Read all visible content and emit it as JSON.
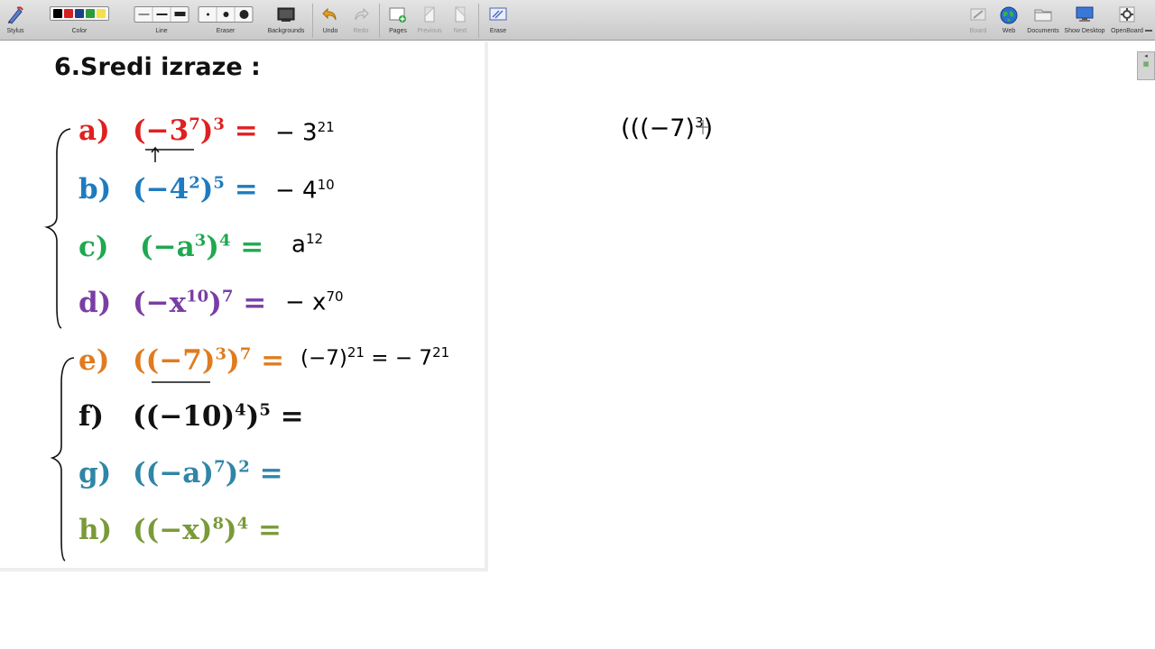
{
  "toolbar": {
    "stylus": "Stylus",
    "color": "Color",
    "line": "Line",
    "eraser": "Eraser",
    "backgrounds": "Backgrounds",
    "undo": "Undo",
    "redo": "Redo",
    "pages": "Pages",
    "previous": "Previous",
    "next": "Next",
    "erase": "Erase",
    "board": "Board",
    "web": "Web",
    "documents": "Documents",
    "show_desktop": "Show Desktop",
    "openboard": "OpenBoard"
  },
  "colors": {
    "swatches": [
      "#000000",
      "#d42020",
      "#1c3f8a",
      "#2a9d3a",
      "#f5e04a"
    ],
    "red": "#e02020",
    "blue": "#1f7bbf",
    "green": "#1fa850",
    "purple": "#7a3ea3",
    "orange": "#e07b20",
    "black": "#111111",
    "teal": "#2f86a6",
    "olive": "#7a9a3a"
  },
  "page": {
    "title": "6.Sredi izraze :",
    "problems": [
      {
        "letter": "a)",
        "base": "(−3",
        "inner_exp": "7",
        "close": ")",
        "outer_exp": "3",
        "eq": "=",
        "answer": "− 3",
        "answer_exp": "21"
      },
      {
        "letter": "b)",
        "base": "(−4",
        "inner_exp": "2",
        "close": ")",
        "outer_exp": "5",
        "eq": "=",
        "answer": "− 4",
        "answer_exp": "10"
      },
      {
        "letter": "c)",
        "base": "(−a",
        "inner_exp": "3",
        "close": ")",
        "outer_exp": "4",
        "eq": "=",
        "answer": "a",
        "answer_exp": "12"
      },
      {
        "letter": "d)",
        "base": "(−x",
        "inner_exp": "10",
        "close": ")",
        "outer_exp": "7",
        "eq": "=",
        "answer": "− x",
        "answer_exp": "70"
      },
      {
        "letter": "e)",
        "base": "((−7)",
        "inner_exp": "3",
        "close": ")",
        "outer_exp": "7",
        "eq": "=",
        "answer": "(−7)",
        "answer_exp": "21",
        "answer2": "= − 7",
        "answer2_exp": "21"
      },
      {
        "letter": "f)",
        "base": "((−10)",
        "inner_exp": "4",
        "close": ")",
        "outer_exp": "5",
        "eq": "="
      },
      {
        "letter": "g)",
        "base": "((−a)",
        "inner_exp": "7",
        "close": ")",
        "outer_exp": "2",
        "eq": "="
      },
      {
        "letter": "h)",
        "base": "((−x)",
        "inner_exp": "8",
        "close": ")",
        "outer_exp": "4",
        "eq": "="
      }
    ]
  },
  "board_note": {
    "text": "((−7)",
    "inner_exp": "3",
    "close": ")"
  }
}
